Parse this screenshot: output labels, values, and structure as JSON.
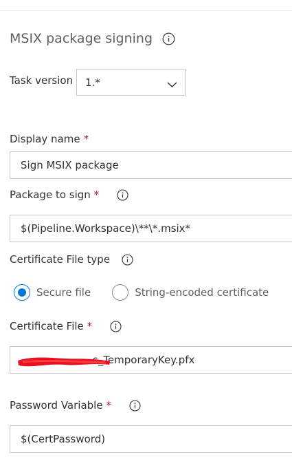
{
  "title": "MSIX package signing",
  "task_version": {
    "label": "Task version",
    "selected": "1.*"
  },
  "display_name": {
    "label": "Display name",
    "required_mark": "*",
    "value": "Sign MSIX package"
  },
  "package_to_sign": {
    "label": "Package to sign",
    "required_mark": "*",
    "value": "$(Pipeline.Workspace)\\**\\*.msix*"
  },
  "certificate_file_type": {
    "label": "Certificate File type",
    "options": [
      {
        "label": "Secure file",
        "selected": true
      },
      {
        "label": "String-encoded certificate",
        "selected": false
      }
    ]
  },
  "certificate_file": {
    "label": "Certificate File",
    "required_mark": "*",
    "value": "s_TemporaryKey.pfx"
  },
  "password_variable": {
    "label": "Password Variable",
    "required_mark": "*",
    "value": "$(CertPassword)"
  },
  "colors": {
    "accent": "#0078d4",
    "required": "#a4262c",
    "border": "#c8c6c4",
    "redaction": "#e81123"
  }
}
